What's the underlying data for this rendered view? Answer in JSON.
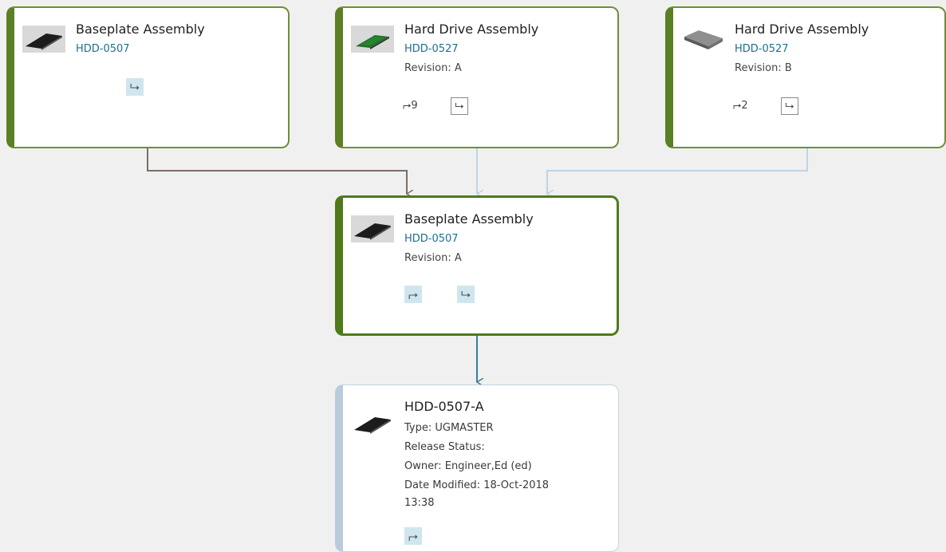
{
  "nodes": {
    "top_left": {
      "title": "Baseplate Assembly",
      "id": "HDD-0507",
      "where_used_icon": "⮡"
    },
    "top_mid": {
      "title": "Hard Drive Assembly",
      "id": "HDD-0527",
      "revision": "Revision: A",
      "children_icon": "⮣",
      "children_count": "9",
      "where_used_icon": "⮡"
    },
    "top_right": {
      "title": "Hard Drive Assembly",
      "id": "HDD-0527",
      "revision": "Revision: B",
      "children_icon": "⮣",
      "children_count": "2",
      "where_used_icon": "⮡"
    },
    "center": {
      "title": "Baseplate Assembly",
      "id": "HDD-0507",
      "revision": "Revision: A",
      "children_icon": "⮣",
      "where_used_icon": "⮡"
    },
    "dataset": {
      "title": "HDD-0507-A",
      "type": "Type: UGMASTER",
      "release_status": "Release Status:",
      "owner": "Owner: Engineer,Ed (ed)",
      "date_modified_line1": "Date Modified: 18-Oct-2018",
      "date_modified_line2": "13:38",
      "children_icon": "⮣"
    }
  },
  "colors": {
    "item_border": "#6f8e35",
    "item_stripe": "#5b7f24",
    "dataset_border": "#b9ccdb",
    "link_text": "#1f6f8f",
    "connector_brown": "#7d6e66",
    "connector_light": "#bfd4e2",
    "connector_blue": "#3e7c9a"
  }
}
